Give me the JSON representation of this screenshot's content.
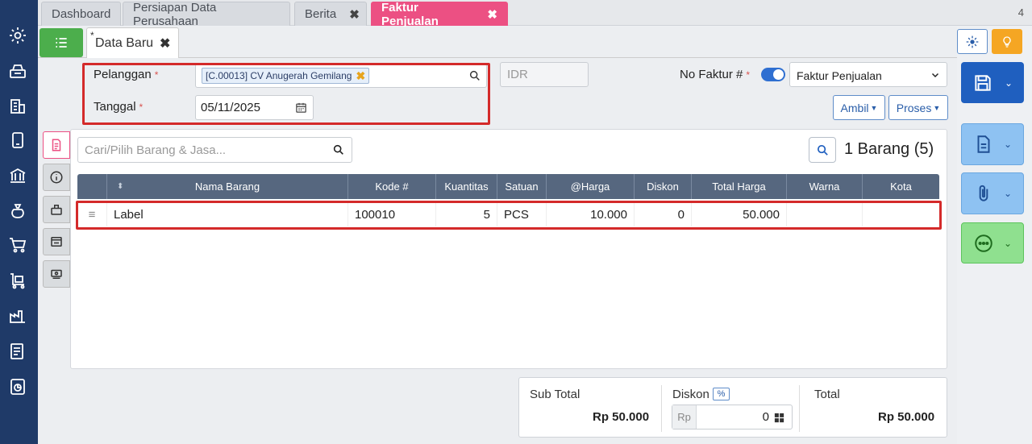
{
  "tabs": [
    {
      "label": "Dashboard",
      "closable": false,
      "active": false
    },
    {
      "label": "Persiapan Data Perusahaan",
      "closable": false,
      "active": false
    },
    {
      "label": "Berita",
      "closable": true,
      "active": false
    },
    {
      "label": "Faktur Penjualan",
      "closable": true,
      "active": true
    }
  ],
  "tab_count": "4",
  "doc_tab": {
    "modified_marker": "*",
    "label": "Data Baru"
  },
  "form": {
    "pelanggan_label": "Pelanggan",
    "pelanggan_value": "[C.00013] CV Anugerah Gemilang",
    "tanggal_label": "Tanggal",
    "tanggal_value": "05/11/2025",
    "currency": "IDR",
    "required_marker": "*",
    "no_faktur_label": "No Faktur #",
    "faktur_type": "Faktur Penjualan",
    "ambil_label": "Ambil",
    "proses_label": "Proses"
  },
  "items": {
    "search_placeholder": "Cari/Pilih Barang & Jasa...",
    "count_text": "1 Barang (5)",
    "columns": [
      "Nama Barang",
      "Kode #",
      "Kuantitas",
      "Satuan",
      "@Harga",
      "Diskon",
      "Total Harga",
      "Warna",
      "Kota"
    ],
    "rows": [
      {
        "nama": "Label",
        "kode": "100010",
        "kuantitas": "5",
        "satuan": "PCS",
        "harga": "10.000",
        "diskon": "0",
        "total": "50.000",
        "warna": "",
        "kota": ""
      }
    ]
  },
  "totals": {
    "subtotal_label": "Sub Total",
    "subtotal_value": "Rp 50.000",
    "diskon_label": "Diskon",
    "diskon_pct": "%",
    "diskon_prefix": "Rp",
    "diskon_value": "0",
    "total_label": "Total",
    "total_value": "Rp 50.000"
  },
  "colors": {
    "accent": "#ec5083",
    "primary": "#1f5fbf",
    "sidebar": "#1f3a68",
    "highlight": "#d42a2a"
  }
}
